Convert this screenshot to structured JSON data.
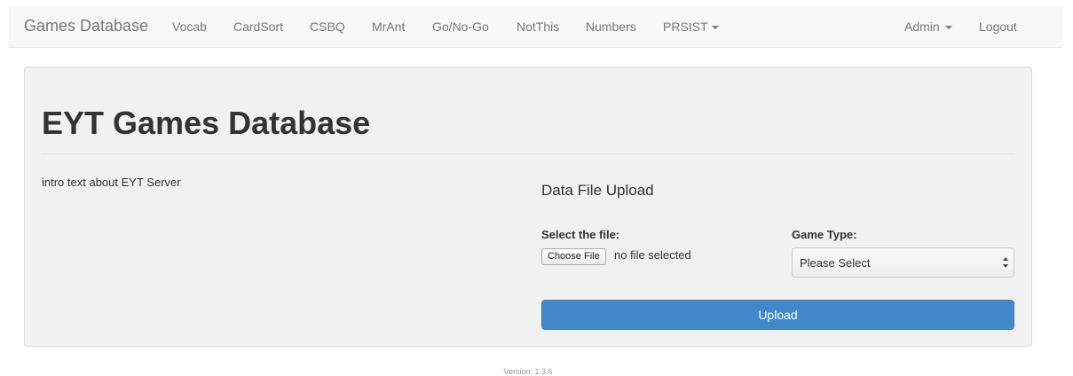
{
  "navbar": {
    "brand": "Games Database",
    "links": [
      "Vocab",
      "CardSort",
      "CSBQ",
      "MrAnt",
      "Go/No-Go",
      "NotThis",
      "Numbers"
    ],
    "prsist_label": "PRSIST",
    "admin_label": "Admin",
    "logout_label": "Logout"
  },
  "jumbotron": {
    "title": "EYT Games Database",
    "intro": "intro text about EYT Server"
  },
  "upload": {
    "heading": "Data File Upload",
    "file_label": "Select the file:",
    "choose_file_label": "Choose File",
    "no_file_text": "no file selected",
    "game_type_label": "Game Type:",
    "game_type_selected": "Please Select",
    "upload_button": "Upload"
  },
  "footer": {
    "version": "Version: 1.3.6"
  },
  "colors": {
    "navbar_bg": "#f8f8f8",
    "nav_text": "#777777",
    "jumbotron_bg": "#f1f1f1",
    "primary_button": "#4289cb"
  },
  "icons": {
    "dropdown_caret": "caret-down-icon",
    "select_arrows": "select-arrows-icon"
  }
}
